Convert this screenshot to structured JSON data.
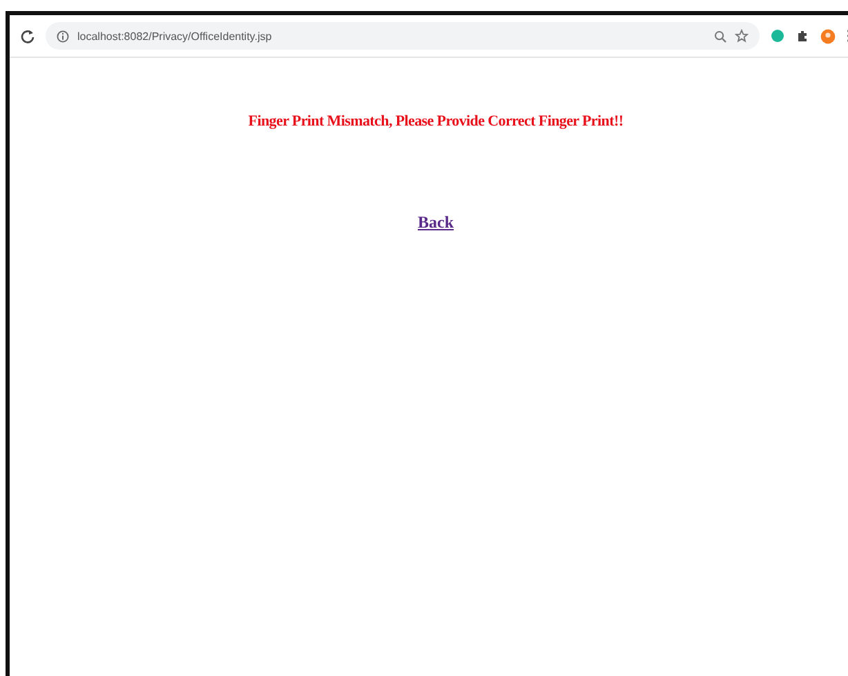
{
  "browser": {
    "address": "localhost:8082/Privacy/OfficeIdentity.jsp"
  },
  "page": {
    "message": "Finger Print Mismatch, Please Provide Correct Finger Print!!",
    "link": "Back"
  }
}
